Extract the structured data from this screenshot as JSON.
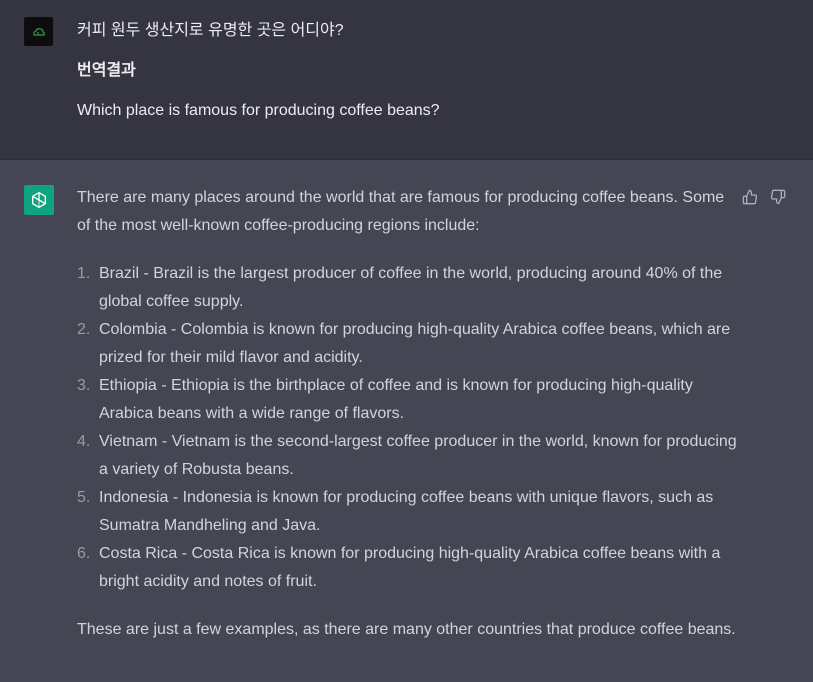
{
  "user_message": {
    "question": "커피 원두 생산지로 유명한 곳은 어디야?",
    "translation_heading": "번역결과",
    "translation": "Which place is famous for producing coffee beans?"
  },
  "assistant_message": {
    "intro": "There are many places around the world that are famous for producing coffee beans. Some of the most well-known coffee-producing regions include:",
    "items": [
      {
        "number": "1.",
        "text": "Brazil - Brazil is the largest producer of coffee in the world, producing around 40% of the global coffee supply."
      },
      {
        "number": "2.",
        "text": "Colombia - Colombia is known for producing high-quality Arabica coffee beans, which are prized for their mild flavor and acidity."
      },
      {
        "number": "3.",
        "text": "Ethiopia - Ethiopia is the birthplace of coffee and is known for producing high-quality Arabica beans with a wide range of flavors."
      },
      {
        "number": "4.",
        "text": "Vietnam - Vietnam is the second-largest coffee producer in the world, known for producing a variety of Robusta beans."
      },
      {
        "number": "5.",
        "text": "Indonesia - Indonesia is known for producing coffee beans with unique flavors, such as Sumatra Mandheling and Java."
      },
      {
        "number": "6.",
        "text": "Costa Rica - Costa Rica is known for producing high-quality Arabica coffee beans with a bright acidity and notes of fruit."
      }
    ],
    "closing": "These are just a few examples, as there are many other countries that produce coffee beans."
  },
  "icons": {
    "user_avatar": "user-avatar-icon",
    "assistant_avatar": "openai-logo-icon",
    "thumb_up": "thumbs-up-icon",
    "thumb_down": "thumbs-down-icon"
  },
  "colors": {
    "user_bg": "#343541",
    "assistant_bg": "#444654",
    "assistant_accent": "#10a37f",
    "text": "#d1d5db"
  }
}
